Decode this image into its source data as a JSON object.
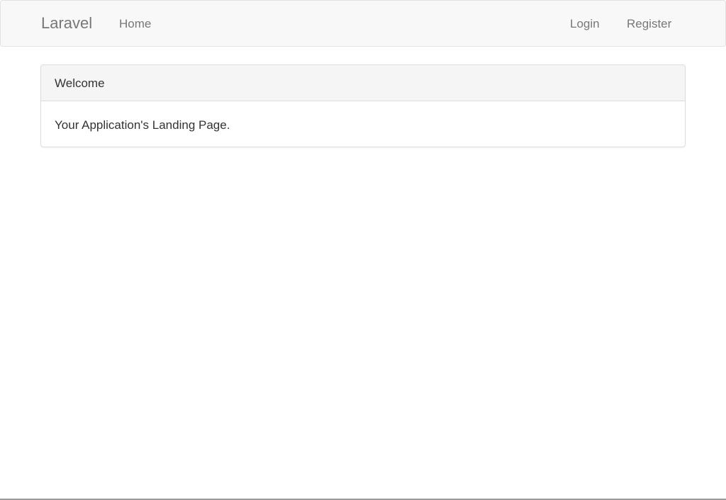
{
  "navbar": {
    "brand": "Laravel",
    "left_links": [
      "Home"
    ],
    "right_links": [
      "Login",
      "Register"
    ]
  },
  "panel": {
    "heading": "Welcome",
    "body": "Your Application's Landing Page."
  }
}
